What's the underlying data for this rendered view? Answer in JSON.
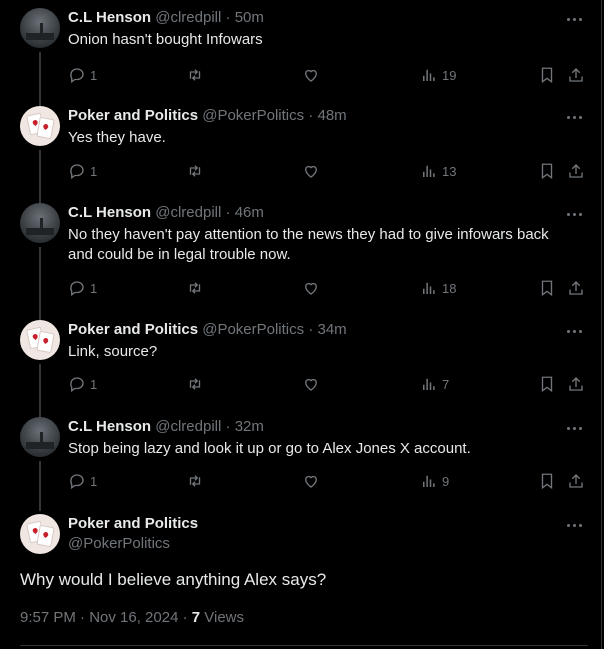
{
  "replies": [
    {
      "author": "C.L Henson",
      "handle": "@clredpill",
      "sep": "·",
      "time": "50m",
      "text": "Onion hasn't bought Infowars",
      "replies": "1",
      "views": "19",
      "avatar": "henson"
    },
    {
      "author": "Poker and Politics",
      "handle": "@PokerPolitics",
      "sep": "·",
      "time": "48m",
      "text": "Yes they have.",
      "replies": "1",
      "views": "13",
      "avatar": "poker"
    },
    {
      "author": "C.L Henson",
      "handle": "@clredpill",
      "sep": "·",
      "time": "46m",
      "text": "No they haven't pay attention to the news they had to give infowars back and could be in legal trouble now.",
      "replies": "1",
      "views": "18",
      "avatar": "henson"
    },
    {
      "author": "Poker and Politics",
      "handle": "@PokerPolitics",
      "sep": "·",
      "time": "34m",
      "text": "Link, source?",
      "replies": "1",
      "views": "7",
      "avatar": "poker"
    },
    {
      "author": "C.L Henson",
      "handle": "@clredpill",
      "sep": "·",
      "time": "32m",
      "text": "Stop being lazy and look it up or go to Alex Jones X account.",
      "replies": "1",
      "views": "9",
      "avatar": "henson"
    }
  ],
  "main": {
    "author": "Poker and Politics",
    "handle": "@PokerPolitics",
    "text": "Why would I believe anything Alex says?",
    "timestamp": "9:57 PM · Nov 16, 2024 · ",
    "views_count": "7",
    "views_label": " Views",
    "avatar": "poker"
  },
  "icons": {
    "reply": "reply-icon",
    "retweet": "retweet-icon",
    "like": "like-icon",
    "views": "views-icon",
    "bookmark": "bookmark-icon",
    "share": "share-icon",
    "more": "more-icon"
  },
  "colors": {
    "background": "#000000",
    "text": "#e7e9ea",
    "muted": "#71767b",
    "thread_line": "#333639"
  }
}
